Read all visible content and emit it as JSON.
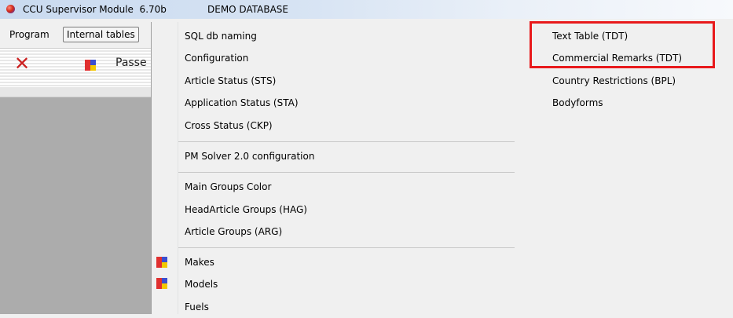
{
  "window": {
    "title": "CCU Supervisor Module  6.70b",
    "database_label": "DEMO DATABASE"
  },
  "menubar": {
    "items": [
      "Program",
      "Internal tables"
    ]
  },
  "toolbar": {
    "label": "Passe"
  },
  "main_menu": {
    "groups": [
      [
        "SQL db naming",
        "Configuration",
        "Article Status (STS)",
        "Application Status (STA)",
        "Cross Status (CKP)"
      ],
      [
        "PM Solver 2.0 configuration"
      ],
      [
        "Main Groups Color",
        "HeadArticle Groups (HAG)",
        "Article Groups (ARG)"
      ],
      [
        "Makes",
        "Models",
        "Fuels"
      ]
    ]
  },
  "submenu": {
    "items": [
      "Text Table (TDT)",
      "Commercial Remarks (TDT)",
      "Country Restrictions (BPL)",
      "Bodyforms"
    ]
  },
  "colors": {
    "highlight": "#e8191b",
    "close": "#cc2020",
    "workspace": "#acacac"
  }
}
